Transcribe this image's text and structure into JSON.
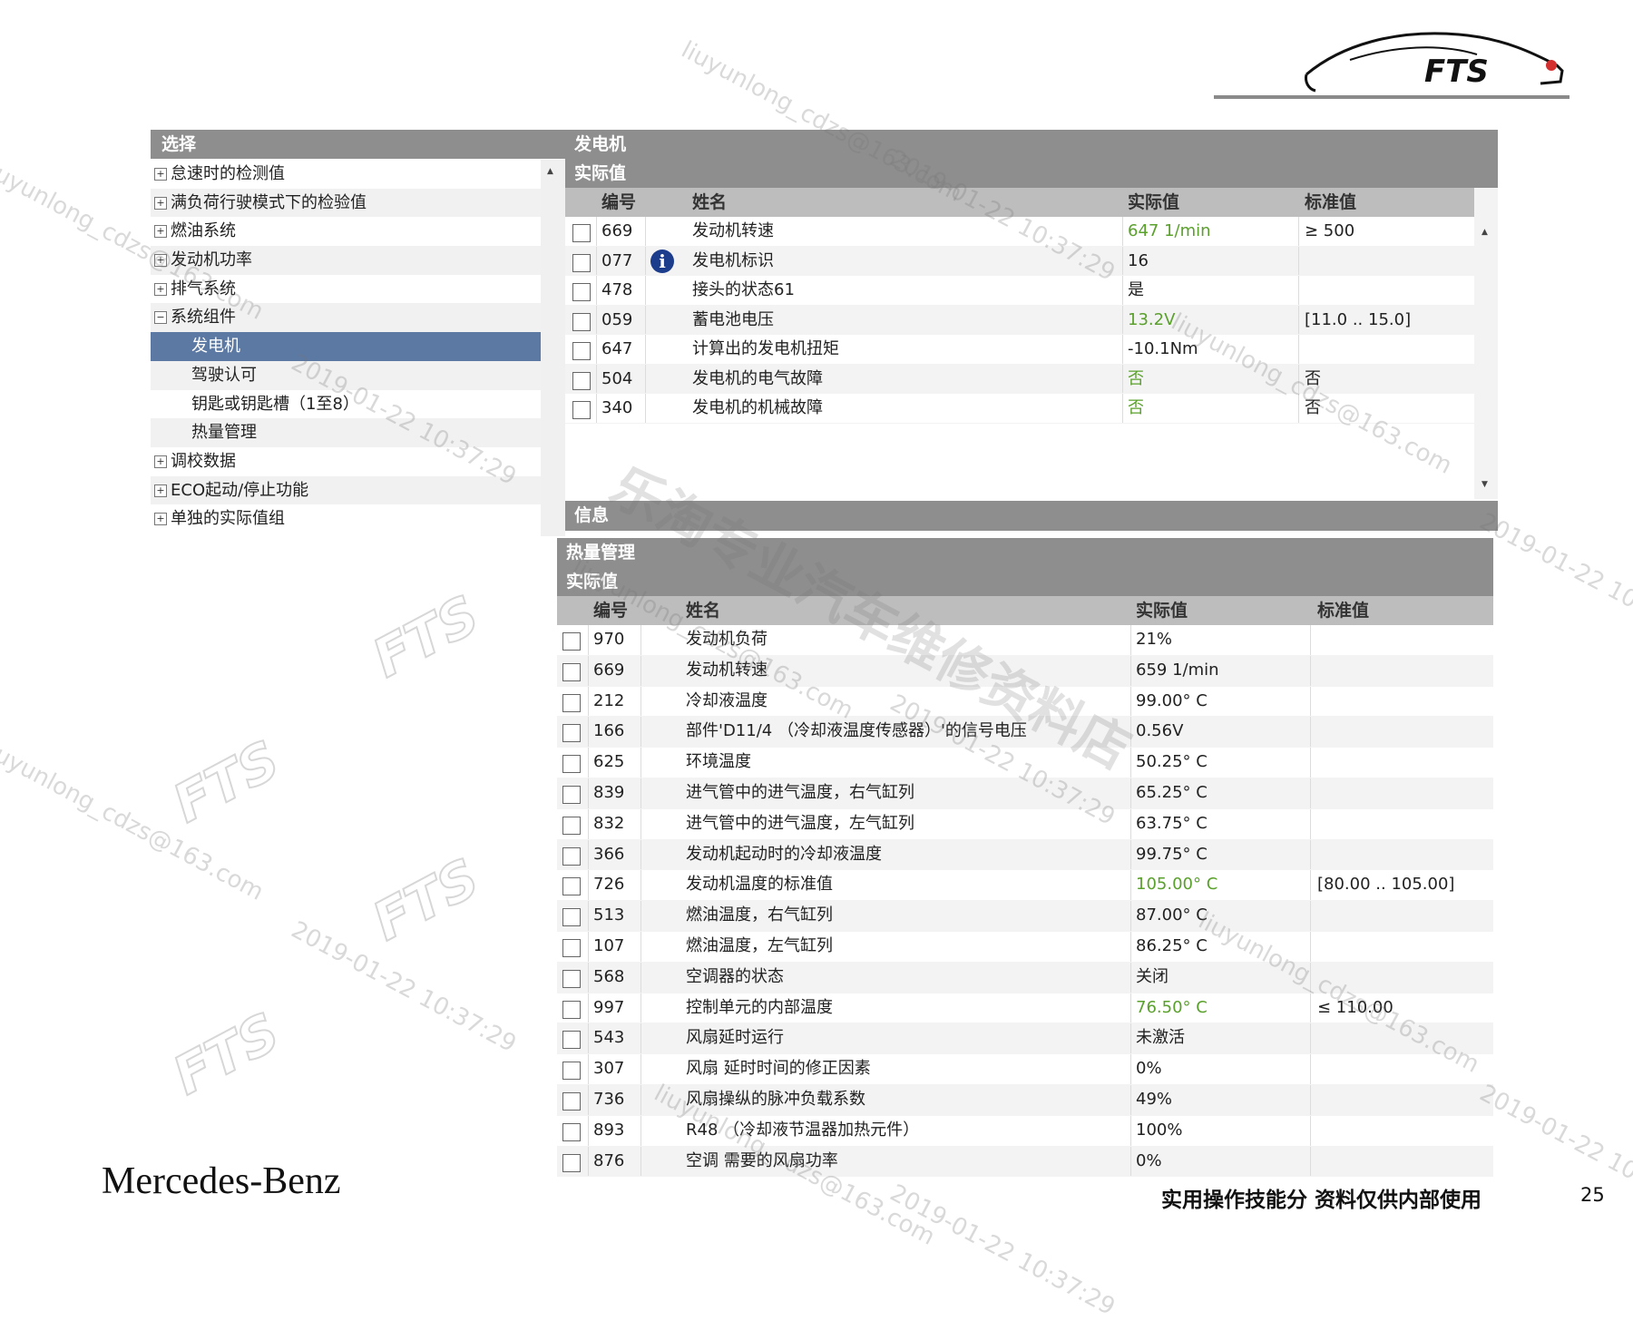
{
  "logo": {
    "text": "FTS"
  },
  "tree": {
    "title": "选择",
    "items": [
      {
        "label": "怠速时的检测值",
        "expander": "+",
        "level": 0
      },
      {
        "label": "满负荷行驶模式下的检验值",
        "expander": "+",
        "level": 0
      },
      {
        "label": "燃油系统",
        "expander": "+",
        "level": 0
      },
      {
        "label": "发动机功率",
        "expander": "+",
        "level": 0
      },
      {
        "label": "排气系统",
        "expander": "+",
        "level": 0
      },
      {
        "label": "系统组件",
        "expander": "−",
        "level": 0
      },
      {
        "label": "发电机",
        "expander": "",
        "level": 1,
        "selected": true
      },
      {
        "label": "驾驶认可",
        "expander": "",
        "level": 1
      },
      {
        "label": "钥匙或钥匙槽（1至8）",
        "expander": "",
        "level": 1
      },
      {
        "label": "热量管理",
        "expander": "",
        "level": 1
      },
      {
        "label": "调校数据",
        "expander": "+",
        "level": 0
      },
      {
        "label": "ECO起动/停止功能",
        "expander": "+",
        "level": 0
      },
      {
        "label": "单独的实际值组",
        "expander": "+",
        "level": 0
      }
    ]
  },
  "generator": {
    "title": "发电机",
    "subtitle": "实际值",
    "columns": {
      "id": "编号",
      "name": "姓名",
      "actual": "实际值",
      "standard": "标准值"
    },
    "rows": [
      {
        "id": "669",
        "name": "发动机转速",
        "actual": "647 1/min",
        "standard": "≥ 500",
        "green": true
      },
      {
        "id": "077",
        "name": "发电机标识",
        "actual": "16",
        "standard": "",
        "info": true
      },
      {
        "id": "478",
        "name": "接头的状态61",
        "actual": "是",
        "standard": ""
      },
      {
        "id": "059",
        "name": "蓄电池电压",
        "actual": "13.2V",
        "standard": "[11.0 .. 15.0]",
        "green": true
      },
      {
        "id": "647",
        "name": "计算出的发电机扭矩",
        "actual": "-10.1Nm",
        "standard": ""
      },
      {
        "id": "504",
        "name": "发电机的电气故障",
        "actual": "否",
        "standard": "否",
        "green": true
      },
      {
        "id": "340",
        "name": "发电机的机械故障",
        "actual": "否",
        "standard": "否",
        "green": true
      }
    ],
    "footer": "信息"
  },
  "heat": {
    "title": "热量管理",
    "subtitle": "实际值",
    "columns": {
      "id": "编号",
      "name": "姓名",
      "actual": "实际值",
      "standard": "标准值"
    },
    "rows": [
      {
        "id": "970",
        "name": "发动机负荷",
        "actual": "21%",
        "standard": ""
      },
      {
        "id": "669",
        "name": "发动机转速",
        "actual": "659 1/min",
        "standard": ""
      },
      {
        "id": "212",
        "name": "冷却液温度",
        "actual": "99.00° C",
        "standard": ""
      },
      {
        "id": "166",
        "name": "部件'D11/4 （冷却液温度传感器）'的信号电压",
        "actual": "0.56V",
        "standard": ""
      },
      {
        "id": "625",
        "name": "环境温度",
        "actual": "50.25° C",
        "standard": ""
      },
      {
        "id": "839",
        "name": "进气管中的进气温度，右气缸列",
        "actual": "65.25° C",
        "standard": ""
      },
      {
        "id": "832",
        "name": "进气管中的进气温度，左气缸列",
        "actual": "63.75° C",
        "standard": ""
      },
      {
        "id": "366",
        "name": "发动机起动时的冷却液温度",
        "actual": "99.75° C",
        "standard": ""
      },
      {
        "id": "726",
        "name": "发动机温度的标准值",
        "actual": "105.00° C",
        "standard": "[80.00 .. 105.00]",
        "green": true
      },
      {
        "id": "513",
        "name": "燃油温度，右气缸列",
        "actual": "87.00° C",
        "standard": ""
      },
      {
        "id": "107",
        "name": "燃油温度，左气缸列",
        "actual": "86.25° C",
        "standard": ""
      },
      {
        "id": "568",
        "name": "空调器的状态",
        "actual": "关闭",
        "standard": ""
      },
      {
        "id": "997",
        "name": "控制单元的内部温度",
        "actual": "76.50° C",
        "standard": "≤ 110.00",
        "green": true
      },
      {
        "id": "543",
        "name": "风扇延时运行",
        "actual": "未激活",
        "standard": ""
      },
      {
        "id": "307",
        "name": "风扇 延时时间的修正因素",
        "actual": "0%",
        "standard": ""
      },
      {
        "id": "736",
        "name": "风扇操纵的脉冲负载系数",
        "actual": "49%",
        "standard": ""
      },
      {
        "id": "893",
        "name": "R48 （冷却液节温器加热元件）",
        "actual": "100%",
        "standard": ""
      },
      {
        "id": "876",
        "name": "空调 需要的风扇功率",
        "actual": "0%",
        "standard": ""
      }
    ]
  },
  "footer": {
    "brand": "Mercedes-Benz",
    "note": "实用操作技能分 资料仅供内部使用",
    "page": "25"
  },
  "watermarks": {
    "email": "liuyunlong_cdzs@163.com",
    "date": "2019-01-22 10:37:29",
    "shop": "乐淘专业汽车维修资料店",
    "fts": "FTS"
  },
  "colors": {
    "header": "#8e8e8e",
    "column_header": "#bdbdbd",
    "selected": "#5c79a3",
    "ok_value": "#5aa02c",
    "info_icon": "#1c3c8c"
  }
}
